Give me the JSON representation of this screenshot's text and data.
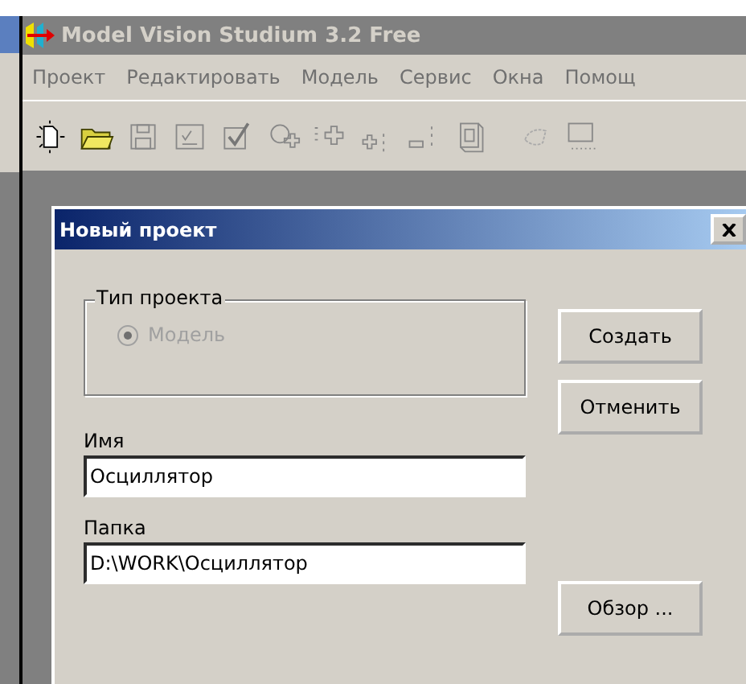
{
  "window": {
    "title": "Model Vision Studium 3.2 Free"
  },
  "menu": [
    "Проект",
    "Редактировать",
    "Модель",
    "Сервис",
    "Окна",
    "Помощ"
  ],
  "dialog": {
    "title": "Новый проект",
    "project_type": {
      "label": "Тип проекта",
      "options": [
        {
          "label": "Модель",
          "selected": true,
          "disabled": true
        }
      ]
    },
    "fields": [
      {
        "label": "Имя",
        "value": "Осциллятор"
      },
      {
        "label": "Папка",
        "value": "D:\\WORK\\Осциллятор"
      }
    ],
    "buttons": {
      "create": "Создать",
      "cancel": "Отменить",
      "browse": "Обзор ..."
    }
  }
}
